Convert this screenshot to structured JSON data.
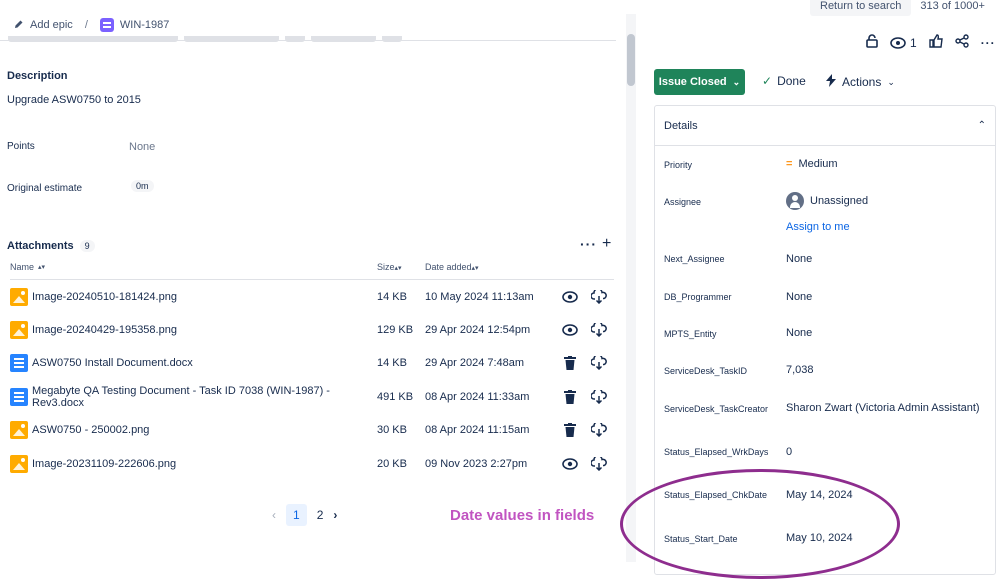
{
  "breadcrumb": {
    "add_epic": "Add epic",
    "separator": "/",
    "issue_key": "WIN-1987"
  },
  "top_right": {
    "return_label": "Return to search",
    "count": "313 of 1000+"
  },
  "description": {
    "heading": "Description",
    "text": "Upgrade ASW0750 to 2015"
  },
  "points": {
    "label": "Points",
    "value": "None"
  },
  "original_estimate": {
    "label": "Original estimate",
    "value": "0m"
  },
  "attachments": {
    "heading": "Attachments",
    "count": "9",
    "columns": {
      "name": "Name",
      "size": "Size",
      "date": "Date added"
    },
    "rows": [
      {
        "name": "Image-20240510-181424.png",
        "size": "14 KB",
        "date": "10 May 2024 11:13am",
        "type": "image",
        "action1": "eye-icon"
      },
      {
        "name": "Image-20240429-195358.png",
        "size": "129 KB",
        "date": "29 Apr 2024 12:54pm",
        "type": "image",
        "action1": "eye-icon"
      },
      {
        "name": "ASW0750 Install Document.docx",
        "size": "14 KB",
        "date": "29 Apr 2024 7:48am",
        "type": "document",
        "action1": "trash-icon"
      },
      {
        "name": "Megabyte QA Testing Document - Task ID 7038 (WIN-1987) - Rev3.docx",
        "size": "491 KB",
        "date": "08 Apr 2024 11:33am",
        "type": "document",
        "action1": "trash-icon"
      },
      {
        "name": "ASW0750 - 250002.png",
        "size": "30 KB",
        "date": "08 Apr 2024 11:15am",
        "type": "image",
        "action1": "trash-icon"
      },
      {
        "name": "Image-20231109-222606.png",
        "size": "20 KB",
        "date": "09 Nov 2023 2:27pm",
        "type": "image",
        "action1": "eye-icon"
      }
    ]
  },
  "pagination": {
    "pages": [
      "1",
      "2"
    ],
    "current": "1"
  },
  "annotation": {
    "text": "Date values in fields",
    "color": "#c154c1",
    "ellipse_color": "#8e2d8e"
  },
  "header_actions": {
    "watch_count": "1"
  },
  "status": {
    "label": "Issue Closed",
    "color": "#1f845a"
  },
  "resolution": {
    "label": "Done"
  },
  "actions_label": "Actions",
  "details": {
    "heading": "Details",
    "priority": {
      "label": "Priority",
      "value": "Medium",
      "color": "#ff991f"
    },
    "assignee": {
      "label": "Assignee",
      "value": "Unassigned",
      "assign_link": "Assign to me"
    },
    "next_assignee": {
      "label": "Next_Assignee",
      "value": "None"
    },
    "db_programmer": {
      "label": "DB_Programmer",
      "value": "None"
    },
    "mpts_entity": {
      "label": "MPTS_Entity",
      "value": "None"
    },
    "task_id": {
      "label": "ServiceDesk_TaskID",
      "value": "7,038"
    },
    "task_creator": {
      "label": "ServiceDesk_TaskCreator",
      "value": "Sharon Zwart (Victoria Admin Assistant)"
    },
    "elapsed_wrkdays": {
      "label": "Status_Elapsed_WrkDays",
      "value": "0"
    },
    "elapsed_chkdate": {
      "label": "Status_Elapsed_ChkDate",
      "value": "May 14, 2024"
    },
    "start_date": {
      "label": "Status_Start_Date",
      "value": "May 10, 2024"
    }
  }
}
